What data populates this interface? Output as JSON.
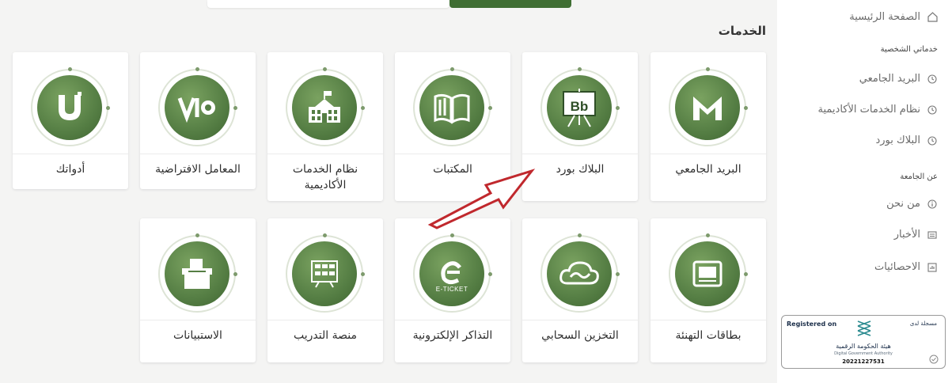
{
  "section_title": "الخدمات",
  "services": [
    {
      "label": "البريد الجامعي",
      "icon": "mail-m-icon"
    },
    {
      "label": "البلاك بورد",
      "icon": "blackboard-icon"
    },
    {
      "label": "المكتبات",
      "icon": "book-icon"
    },
    {
      "label": "نظام الخدمات الأكاديمية",
      "icon": "school-building-icon"
    },
    {
      "label": "المعامل الافتراضية",
      "icon": "virtual-lab-icon"
    },
    {
      "label": "أدواتك",
      "icon": "u-tools-icon"
    },
    {
      "label": "بطاقات التهنئة",
      "icon": "greeting-card-icon"
    },
    {
      "label": "التخزين السحابي",
      "icon": "cloud-icon"
    },
    {
      "label": "التذاكر الإلكترونية",
      "icon": "e-ticket-icon"
    },
    {
      "label": "منصة التدريب",
      "icon": "training-board-icon"
    },
    {
      "label": "الاستبيانات",
      "icon": "ballot-box-icon"
    }
  ],
  "icon_text": {
    "blackboard": "Bb",
    "eticket": "E-TICKET",
    "vlab": "Vl"
  },
  "sidebar": {
    "home": "الصفحة الرئيسية",
    "my_services_heading": "خدماتي الشخصية",
    "my_services": [
      "البريد الجامعي",
      "نظام الخدمات الأكاديمية",
      "البلاك بورد"
    ],
    "about_heading": "عن الجامعة",
    "about": [
      "من نحن",
      "الأخبار",
      "الاحصائيات"
    ]
  },
  "badge": {
    "registered_en": "Registered on",
    "registered_ar": "مسجلة لدى",
    "authority_ar": "هيئة الحكومة الرقمية",
    "authority_en": "Digital Government Authority",
    "number": "20221227531"
  },
  "colors": {
    "accent": "#3f6e33",
    "circle": "#557e44",
    "arrow": "#c0282d"
  }
}
